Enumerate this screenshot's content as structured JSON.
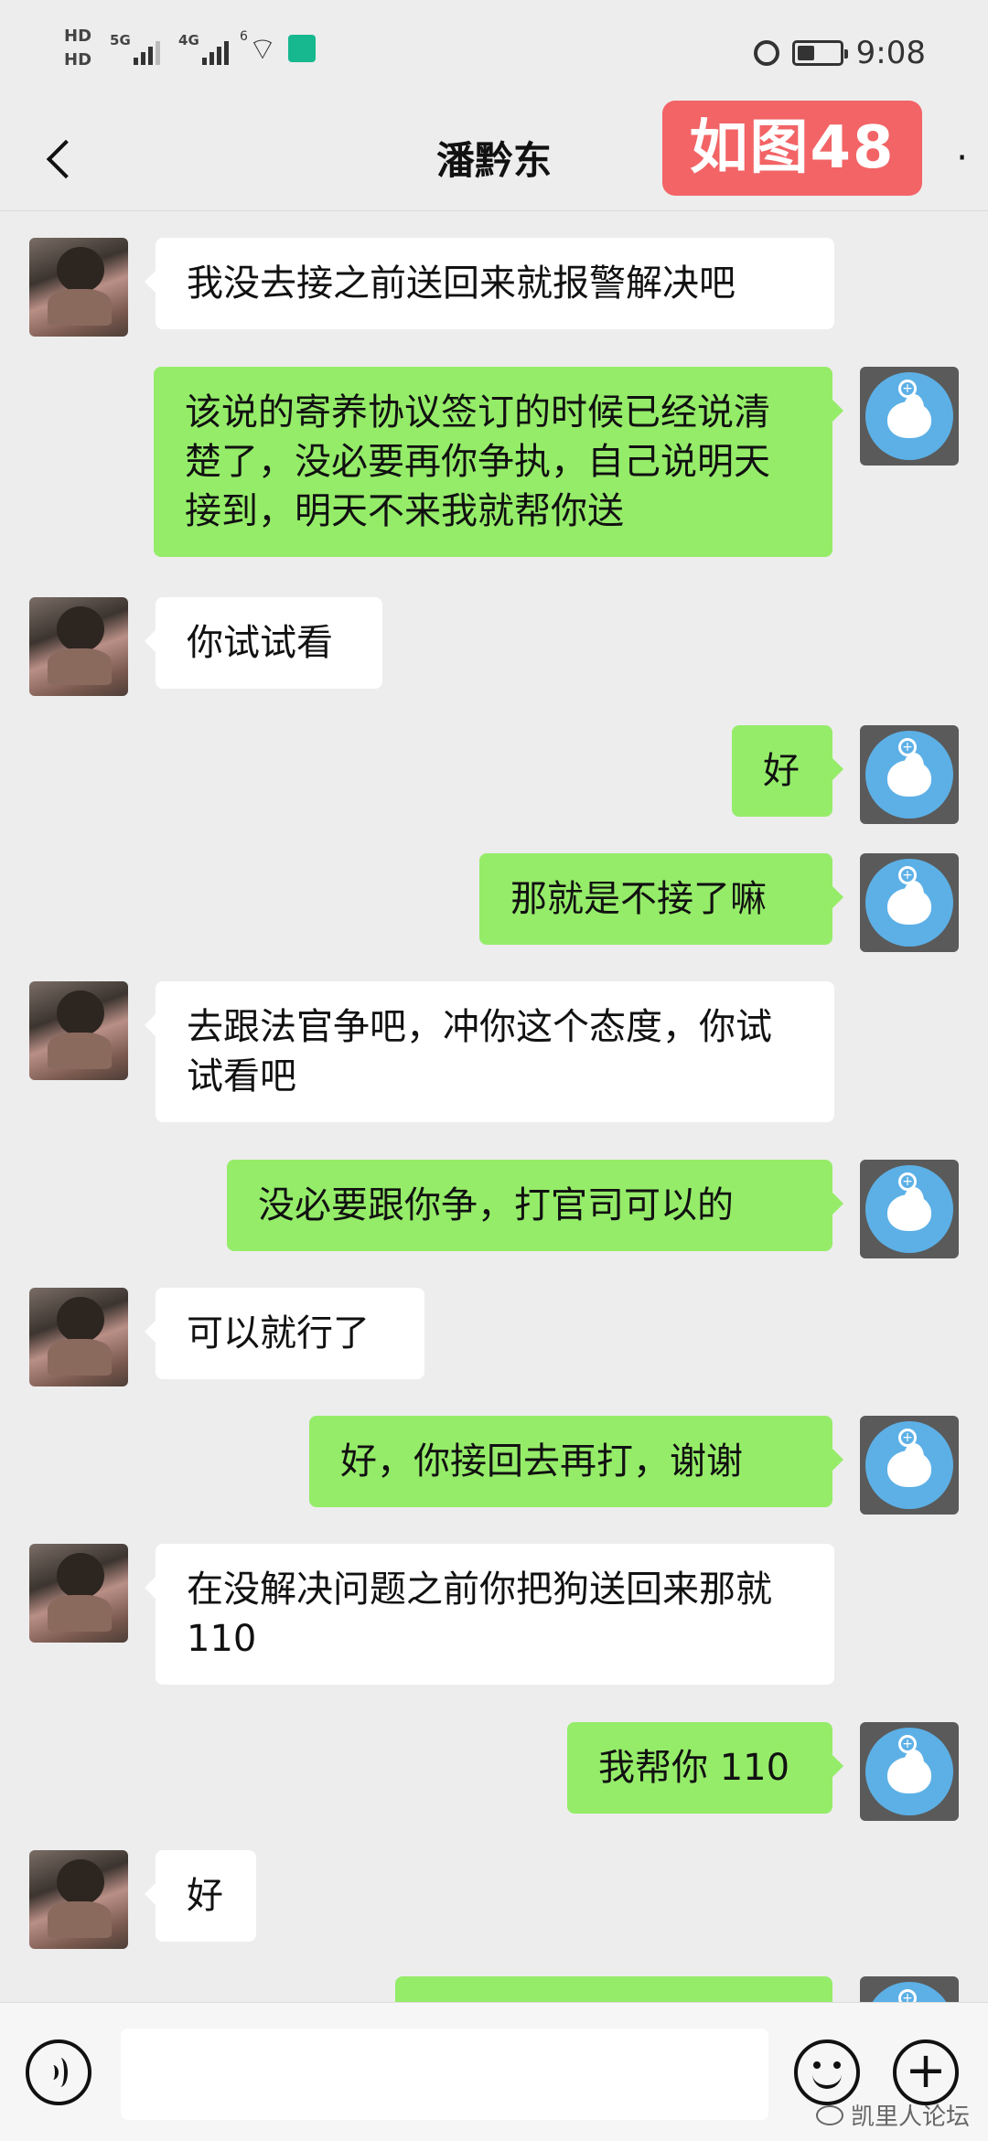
{
  "status_bar": {
    "hd1": "HD",
    "hd2": "HD",
    "net1": "5G",
    "net2": "4G",
    "wifi_label": "6",
    "time": "9:08",
    "icons": [
      "alarm-icon",
      "battery-icon",
      "wifi-icon",
      "signal-icon"
    ]
  },
  "header": {
    "title": "潘黔东",
    "stamp": "如图48",
    "more": "·"
  },
  "messages": [
    {
      "side": "in",
      "text": "我没去接之前送回来就报警解决吧"
    },
    {
      "side": "out",
      "text": "该说的寄养协议签订的时候已经说清楚了，没必要再你争执，自己说明天接到，明天不来我就帮你送"
    },
    {
      "side": "in",
      "text": "你试试看"
    },
    {
      "side": "out",
      "text": "好"
    },
    {
      "side": "out",
      "text": "那就是不接了嘛"
    },
    {
      "side": "in",
      "text": "去跟法官争吧，冲你这个态度，你试试看吧"
    },
    {
      "side": "out",
      "text": "没必要跟你争，打官司可以的"
    },
    {
      "side": "in",
      "text": "可以就行了"
    },
    {
      "side": "out",
      "text": "好，你接回去再打，谢谢"
    },
    {
      "side": "in",
      "text": "在没解决问题之前你把狗送回来那就 110"
    },
    {
      "side": "out",
      "text": "我帮你 110"
    },
    {
      "side": "in",
      "text": "好"
    },
    {
      "side": "out",
      "text": ""
    }
  ],
  "input_bar": {
    "input_value": "",
    "watermark": "凯里人论坛"
  }
}
